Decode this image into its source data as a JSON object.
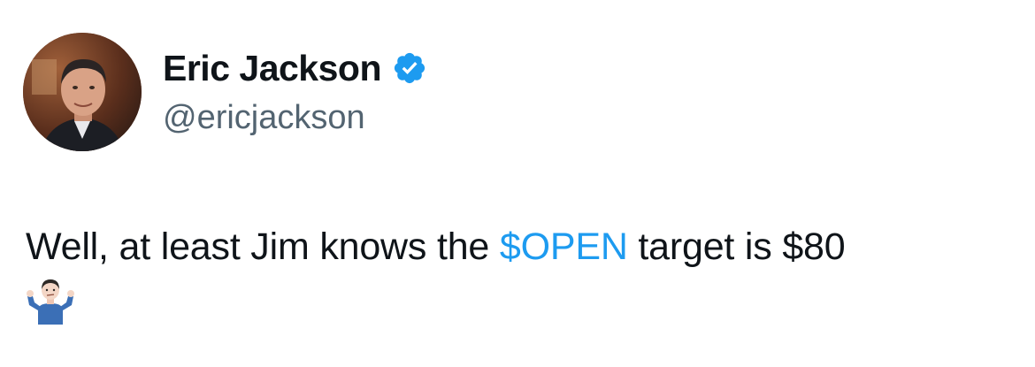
{
  "author": {
    "display_name": "Eric Jackson",
    "handle": "@ericjackson",
    "verified": true
  },
  "tweet": {
    "text_before": "Well, at least Jim knows the ",
    "cashtag": "$OPEN",
    "text_after": " target is $80",
    "emoji": "person-shrugging"
  },
  "colors": {
    "link": "#1d9bf0",
    "secondary_text": "#536471",
    "primary_text": "#0f1419",
    "verified_badge": "#1d9bf0"
  },
  "icons": {
    "verified": "verified-badge-icon",
    "emoji": "person-shrugging-icon"
  }
}
